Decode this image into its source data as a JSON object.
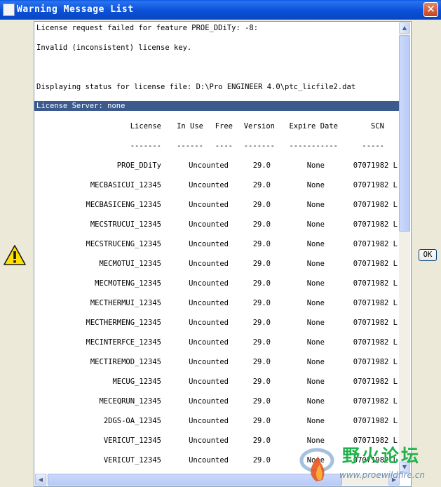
{
  "window": {
    "title": "Warning Message List",
    "close_glyph": "✕"
  },
  "messages": {
    "line1": "License request failed for feature PROE_DDiTy: -8:",
    "line2": "Invalid (inconsistent) license key.",
    "line3": "Displaying status for license file: D:\\Pro ENGINEER 4.0\\ptc_licfile2.dat",
    "server": "License Server: none"
  },
  "table": {
    "headers": [
      "License",
      "In Use",
      "Free",
      "Version",
      "Expire Date",
      "SCN"
    ],
    "separators": [
      "-------",
      "------",
      "----",
      "-------",
      "-----------",
      "-----"
    ],
    "rows": [
      [
        "PROE_DDiTy",
        "Uncounted",
        "29.0",
        "None",
        "07071982 L"
      ],
      [
        "MECBASICUI_12345",
        "Uncounted",
        "29.0",
        "None",
        "07071982 L"
      ],
      [
        "MECBASICENG_12345",
        "Uncounted",
        "29.0",
        "None",
        "07071982 L"
      ],
      [
        "MECSTRUCUI_12345",
        "Uncounted",
        "29.0",
        "None",
        "07071982 L"
      ],
      [
        "MECSTRUCENG_12345",
        "Uncounted",
        "29.0",
        "None",
        "07071982 L"
      ],
      [
        "MECMOTUI_12345",
        "Uncounted",
        "29.0",
        "None",
        "07071982 L"
      ],
      [
        "MECMOTENG_12345",
        "Uncounted",
        "29.0",
        "None",
        "07071982 L"
      ],
      [
        "MECTHERMUI_12345",
        "Uncounted",
        "29.0",
        "None",
        "07071982 L"
      ],
      [
        "MECTHERMENG_12345",
        "Uncounted",
        "29.0",
        "None",
        "07071982 L"
      ],
      [
        "MECINTERFCE_12345",
        "Uncounted",
        "29.0",
        "None",
        "07071982 L"
      ],
      [
        "MECTIREMOD_12345",
        "Uncounted",
        "29.0",
        "None",
        "07071982 L"
      ],
      [
        "MECUG_12345",
        "Uncounted",
        "29.0",
        "None",
        "07071982 L"
      ],
      [
        "MECEQRUN_12345",
        "Uncounted",
        "29.0",
        "None",
        "07071982 L"
      ],
      [
        "2DGS-OA_12345",
        "Uncounted",
        "29.0",
        "None",
        "07071982 L"
      ],
      [
        "VERICUT_12345",
        "Uncounted",
        "29.0",
        "None",
        "07071982 L"
      ],
      [
        "VERICUT_12345",
        "Uncounted",
        "29.0",
        "None",
        "07071982 L"
      ]
    ]
  },
  "buttons": {
    "ok": "OK"
  },
  "icons": {
    "title": "window-icon",
    "warning": "warning-icon",
    "scroll_up": "▲",
    "scroll_down": "▼",
    "scroll_left": "◀",
    "scroll_right": "▶"
  },
  "watermark": {
    "text_cn": "野火论坛",
    "url": "www.proewildfire.cn"
  },
  "colors": {
    "titlebar": "#0a50d8",
    "selection": "#3c5a8e",
    "watermark": "#22b24c"
  }
}
